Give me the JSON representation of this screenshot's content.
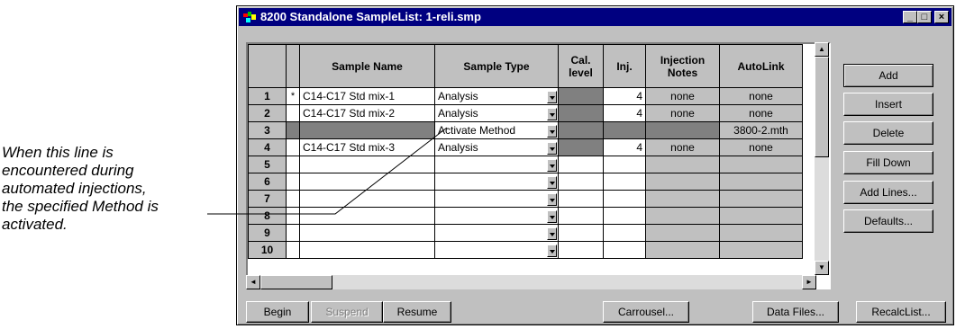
{
  "callout": {
    "lines": [
      "When this line is",
      "encountered during",
      "automated injections,",
      "the specified Method is",
      "activated."
    ]
  },
  "window": {
    "title": "8200 Standalone SampleList: 1-reli.smp",
    "minimize_glyph": "_",
    "maximize_glyph": "□",
    "close_glyph": "×"
  },
  "grid": {
    "headers": {
      "sample_name": "Sample Name",
      "sample_type": "Sample Type",
      "cal_level": "Cal. level",
      "inj": "Inj.",
      "injection_notes": "Injection Notes",
      "autolink": "AutoLink"
    },
    "rows": [
      {
        "num": "1",
        "marker": "*",
        "name": "C14-C17 Std mix-1",
        "type": "Analysis",
        "inj": "4",
        "notes": "none",
        "autolink": "none"
      },
      {
        "num": "2",
        "marker": "",
        "name": "C14-C17 Std mix-2",
        "type": "Analysis",
        "inj": "4",
        "notes": "none",
        "autolink": "none"
      },
      {
        "num": "3",
        "marker": "",
        "name": "",
        "type": "Activate Method",
        "inj": "",
        "notes": "",
        "autolink": "3800-2.mth"
      },
      {
        "num": "4",
        "marker": "",
        "name": "C14-C17 Std mix-3",
        "type": "Analysis",
        "inj": "4",
        "notes": "none",
        "autolink": "none"
      },
      {
        "num": "5",
        "marker": "",
        "name": "",
        "type": "",
        "inj": "",
        "notes": "",
        "autolink": ""
      },
      {
        "num": "6",
        "marker": "",
        "name": "",
        "type": "",
        "inj": "",
        "notes": "",
        "autolink": ""
      },
      {
        "num": "7",
        "marker": "",
        "name": "",
        "type": "",
        "inj": "",
        "notes": "",
        "autolink": ""
      },
      {
        "num": "8",
        "marker": "",
        "name": "",
        "type": "",
        "inj": "",
        "notes": "",
        "autolink": ""
      },
      {
        "num": "9",
        "marker": "",
        "name": "",
        "type": "",
        "inj": "",
        "notes": "",
        "autolink": ""
      },
      {
        "num": "10",
        "marker": "",
        "name": "",
        "type": "",
        "inj": "",
        "notes": "",
        "autolink": ""
      }
    ]
  },
  "side_buttons": {
    "add": "Add",
    "insert": "Insert",
    "delete": "Delete",
    "fill_down": "Fill Down",
    "add_lines": "Add Lines...",
    "defaults": "Defaults..."
  },
  "bottom_buttons": {
    "begin": "Begin",
    "suspend": "Suspend",
    "resume": "Resume",
    "carrousel": "Carrousel...",
    "data_files": "Data Files...",
    "recalc_list": "RecalcList..."
  },
  "colors": {
    "titlebar": "#000080",
    "window_face": "#c0c0c0",
    "disabled_cell": "#808080"
  }
}
